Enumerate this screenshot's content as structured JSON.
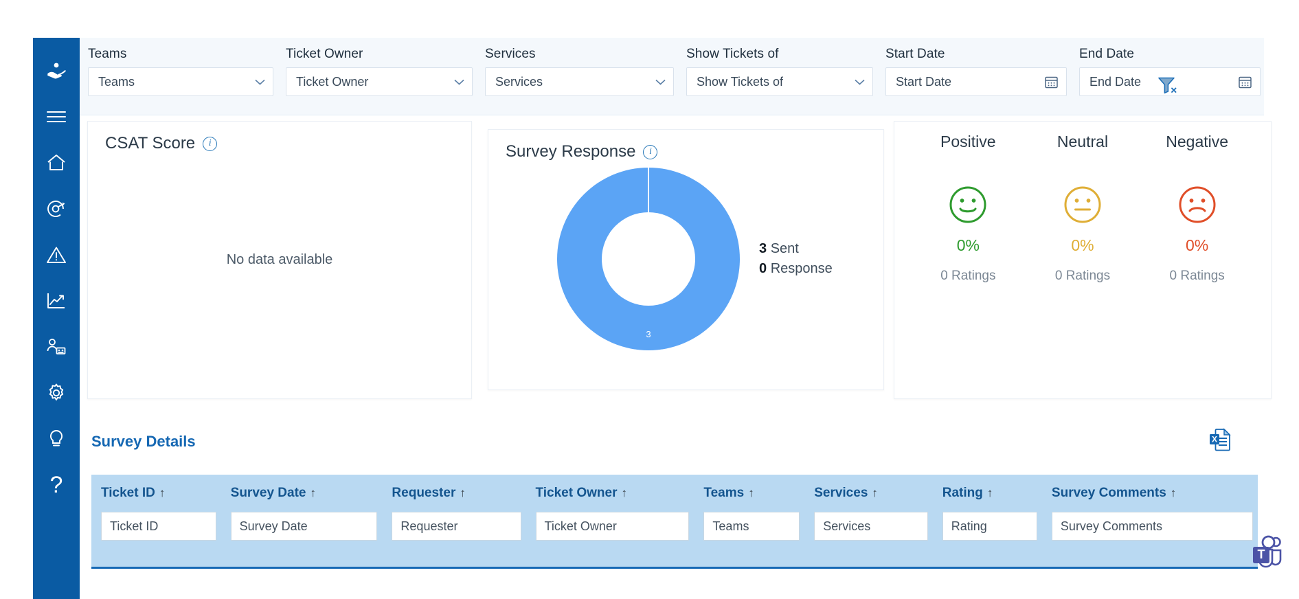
{
  "sidebar": {
    "items": [
      {
        "name": "support-hand-icon",
        "label": "Support"
      },
      {
        "name": "hamburger-menu-icon",
        "label": "Menu"
      },
      {
        "name": "home-icon",
        "label": "Home"
      },
      {
        "name": "dashboard-gauge-icon",
        "label": "Dashboard"
      },
      {
        "name": "alert-warning-icon",
        "label": "Alerts"
      },
      {
        "name": "analytics-chart-icon",
        "label": "Analytics"
      },
      {
        "name": "user-management-icon",
        "label": "Users"
      },
      {
        "name": "settings-gear-icon",
        "label": "Settings"
      },
      {
        "name": "lightbulb-icon",
        "label": "Ideas"
      },
      {
        "name": "help-question-icon",
        "label": "Help"
      }
    ]
  },
  "filters": {
    "teams": {
      "label": "Teams",
      "value": "Teams"
    },
    "ticket_owner": {
      "label": "Ticket Owner",
      "value": "Ticket Owner"
    },
    "services": {
      "label": "Services",
      "value": "Services"
    },
    "show_tickets_of": {
      "label": "Show Tickets of",
      "value": "Show Tickets of"
    },
    "start_date": {
      "label": "Start Date",
      "value": "Start Date"
    },
    "end_date": {
      "label": "End Date",
      "value": "End Date"
    },
    "clear_filter_icon": "clear-filter-funnel-icon"
  },
  "csat": {
    "title": "CSAT Score",
    "info_icon": "info-icon",
    "empty_message": "No data available"
  },
  "survey_response": {
    "title": "Survey Response",
    "info_icon": "info-icon",
    "segment_label": "3",
    "sent_value": "3",
    "sent_label": "Sent",
    "response_value": "0",
    "response_label": "Response"
  },
  "sentiment": [
    {
      "name": "Positive",
      "icon": "smiley-happy-icon",
      "percent": "0%",
      "ratings": "0 Ratings",
      "color": "#2e9b2e"
    },
    {
      "name": "Neutral",
      "icon": "smiley-neutral-icon",
      "percent": "0%",
      "ratings": "0 Ratings",
      "color": "#dfae36"
    },
    {
      "name": "Negative",
      "icon": "smiley-sad-icon",
      "percent": "0%",
      "ratings": "0 Ratings",
      "color": "#e04e28"
    }
  ],
  "details": {
    "title": "Survey Details",
    "export_icon": "excel-export-icon",
    "sort_arrow": "↑",
    "columns": [
      {
        "label": "Ticket ID",
        "filter_placeholder": "Ticket ID"
      },
      {
        "label": "Survey Date",
        "filter_placeholder": "Survey Date"
      },
      {
        "label": "Requester",
        "filter_placeholder": "Requester"
      },
      {
        "label": "Ticket Owner",
        "filter_placeholder": "Ticket Owner"
      },
      {
        "label": "Teams",
        "filter_placeholder": "Teams"
      },
      {
        "label": "Services",
        "filter_placeholder": "Services"
      },
      {
        "label": "Rating",
        "filter_placeholder": "Rating"
      },
      {
        "label": "Survey Comments",
        "filter_placeholder": "Survey Comments"
      }
    ],
    "rows": []
  },
  "teams_fab": {
    "icon": "microsoft-teams-icon"
  },
  "chart_data": {
    "type": "pie",
    "title": "Survey Response",
    "categories": [
      "Sent"
    ],
    "values": [
      3
    ],
    "labels": [
      "3"
    ],
    "colors": [
      "#5ba4f5"
    ],
    "donut": true,
    "legend": [
      {
        "value": 3,
        "name": "Sent"
      },
      {
        "value": 0,
        "name": "Response"
      }
    ]
  }
}
